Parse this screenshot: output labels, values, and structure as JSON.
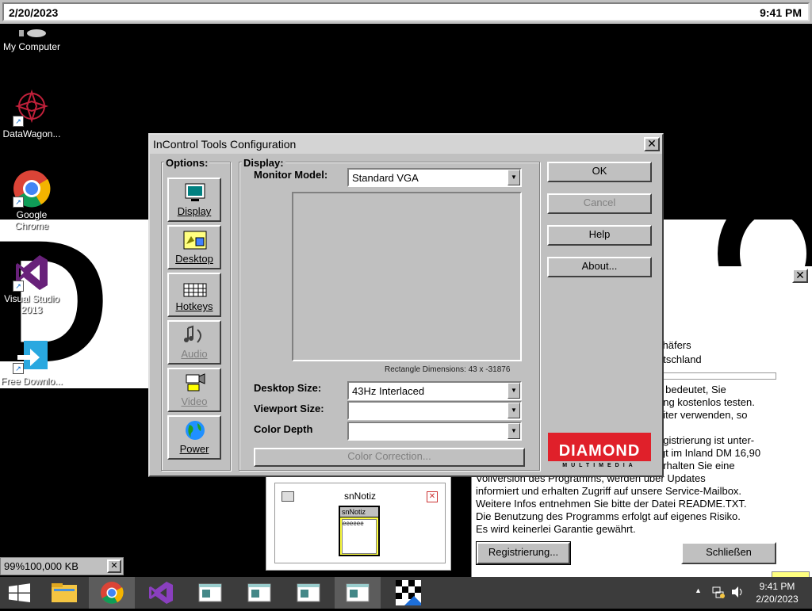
{
  "topbar": {
    "date": "2/20/2023",
    "time": "9:41 PM"
  },
  "desktop_icons": [
    {
      "label": "My Computer"
    },
    {
      "label": "DataWagon..."
    },
    {
      "label": "Google Chrome"
    },
    {
      "label": "Visual Studio 2013"
    },
    {
      "label": "Free Downlo..."
    }
  ],
  "dialog": {
    "title": "InControl Tools Configuration",
    "options_label": "Options:",
    "options": [
      {
        "label": "Display",
        "enabled": true
      },
      {
        "label": "Desktop",
        "enabled": true
      },
      {
        "label": "Hotkeys",
        "enabled": true
      },
      {
        "label": "Audio",
        "enabled": false
      },
      {
        "label": "Video",
        "enabled": false
      },
      {
        "label": "Power",
        "enabled": true
      }
    ],
    "display_label": "Display:",
    "monitor_model_label": "Monitor Model:",
    "monitor_model_value": "Standard VGA",
    "rect_dims": "Rectangle Dimensions:  43 x -31876",
    "desktop_size_label": "Desktop Size:",
    "desktop_size_value": "43Hz Interlaced",
    "viewport_size_label": "Viewport Size:",
    "viewport_size_value": "",
    "color_depth_label": "Color Depth",
    "color_depth_value": "",
    "color_correction": "Color Correction...",
    "buttons": {
      "ok": "OK",
      "cancel": "Cancel",
      "help": "Help",
      "about": "About..."
    },
    "logo_text": "DIAMOND",
    "logo_sub": "MULTIMEDIA"
  },
  "bg_dialog": {
    "lines": [
      "chäfers",
      "utschland",
      "s bedeutet, Sie",
      "ang kostenlos testen.",
      "eiter verwenden, so",
      "egistrierung ist unter-",
      "igt im Inland DM 16,90",
      "erhalten Sie eine",
      "Vollversion des Programms, werden über Updates",
      "informiert und erhalten Zugriff auf unsere Service-Mailbox.",
      "Weitere Infos entnehmen Sie bitte der Datei README.TXT.",
      "Die Benutzung des Programms erfolgt auf eigenes Risiko.",
      "Es wird keinerlei Garantie gewährt."
    ],
    "register_button": "Registrierung...",
    "close_button": "Schließen"
  },
  "snnotiz": {
    "title": "snNotiz",
    "inner_title": "snNotiz",
    "inner_text": "eeeeee"
  },
  "memory_bar": {
    "text": "99%100,000 KB"
  },
  "taskbar": {
    "time": "9:41 PM",
    "date": "2/20/2023"
  }
}
